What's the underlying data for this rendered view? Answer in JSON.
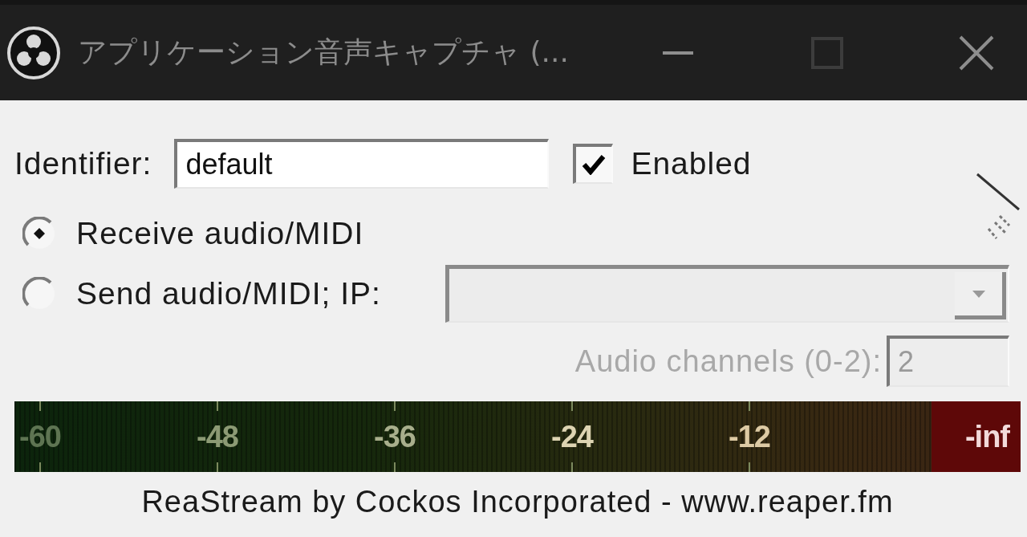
{
  "window": {
    "title": "アプリケーション音声キャプチャ (...",
    "controls": [
      {
        "kind": "minimize",
        "disabled": false
      },
      {
        "kind": "maximize",
        "disabled": true
      },
      {
        "kind": "close",
        "disabled": false
      }
    ]
  },
  "identifier": {
    "label": "Identifier:",
    "value": "default"
  },
  "enabled": {
    "label": "Enabled",
    "checked": true
  },
  "mode": [
    {
      "label": "Receive audio/MIDI",
      "selected": true
    },
    {
      "label": "Send audio/MIDI; IP:",
      "selected": false
    }
  ],
  "ip_dropdown": {
    "disabled": true
  },
  "audio_channels": {
    "label": "Audio channels (0-2):",
    "value": "2",
    "disabled": true
  },
  "meter": {
    "scale": [
      "-60",
      "-48",
      "-36",
      "-24",
      "-12"
    ],
    "reading": "-inf"
  },
  "footer": "ReaStream by Cockos Incorporated - www.reaper.fm"
}
